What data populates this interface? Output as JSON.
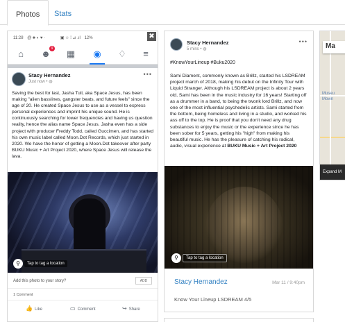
{
  "tabs": [
    {
      "label": "Photos",
      "active": true
    },
    {
      "label": "Stats",
      "active": false
    }
  ],
  "card1": {
    "status_bar": {
      "time": "11:28",
      "left_icons": "@ ♣ ◐ ♥ ·",
      "right_icons": "▣ ☆ ⁞ ⊿ .ıl",
      "battery": "12%"
    },
    "nav_icons": [
      {
        "name": "home-icon",
        "glyph": "⌂"
      },
      {
        "name": "groups-icon",
        "glyph": "☻",
        "badge": "9"
      },
      {
        "name": "marketplace-icon",
        "glyph": "▦"
      },
      {
        "name": "profile-icon",
        "glyph": "◉",
        "selected": true
      },
      {
        "name": "bell-icon",
        "glyph": "♢"
      },
      {
        "name": "menu-icon",
        "glyph": "≡"
      }
    ],
    "post": {
      "author": "Stacy Hernandez",
      "meta": "Just now • ◍",
      "body": "Saving the best for last, Jasha Tull, aka Space Jesus, has been making \"alien basslines, gangster beats, and future feels\" since the age of 20. He created Space Jesus to use as a vessel to express personal experiences and imprint his unique sound. He is continuously searching for lower frequencies and having us question reality, hence the alias name Space Jesus. Jasha even has a side project with producer Freddy Todd, called Guccimen, and has started his own music label called Moon.Dot Records, which just started in 2020. We have the honor of getting a Moon.Dot takeover after party BUKU Music + Art Project 2020, where Space Jesus will release the lava.",
      "tag_location": "Tap to tag a location",
      "story_prompt": "Add this photo to your story?",
      "add_label": "ADD",
      "comments": "1 Comment",
      "actions": [
        {
          "name": "like",
          "label": "Like",
          "icon": "thumbs-up-icon",
          "glyph": "👍"
        },
        {
          "name": "comment",
          "label": "Comment",
          "icon": "comment-icon",
          "glyph": "▭"
        },
        {
          "name": "share",
          "label": "Share",
          "icon": "share-icon",
          "glyph": "↪"
        }
      ]
    }
  },
  "card2": {
    "author": "Stacy Hernandez",
    "meta": "5 mins • ◍",
    "hashtags": "#KnowYourLineup #Buku2020",
    "body_text": "Sami Diament, commonly known as Brillz, started his LSDREAM project march of 2018, making his debut on the Infinity Tour with Liquid Stranger. Although his LSDREAM project is about 2 years old, Sami has been in the music industry for 16 years! Starting off as a drummer in a band, to being the twonk lord Brillz, and now one of the most influential psychedelic artists. Sami started from the bottom, being homeless and living in a studio, and worked his ass off to the top. He is proof that you don't need any drug substances to enjoy the music or the experience since he has been sober for 5 years, getting his \"high\" from making his beautiful music. He has the pleasure of catching his radical, audio, visual experience at",
    "body_bold": "BUKU Music + Art Project 2020",
    "tag_location": "Tap to tag a location",
    "footer_name": "Stacy Hernandez",
    "footer_date": "Mar 11 / 9:40pm",
    "footer_caption": "Know Your Lineup LSDREAM 4/5"
  },
  "card3": {
    "map_label": "Ma",
    "place": "Museu\nMovin",
    "expand": "Expand M"
  },
  "close_glyph": "✖"
}
